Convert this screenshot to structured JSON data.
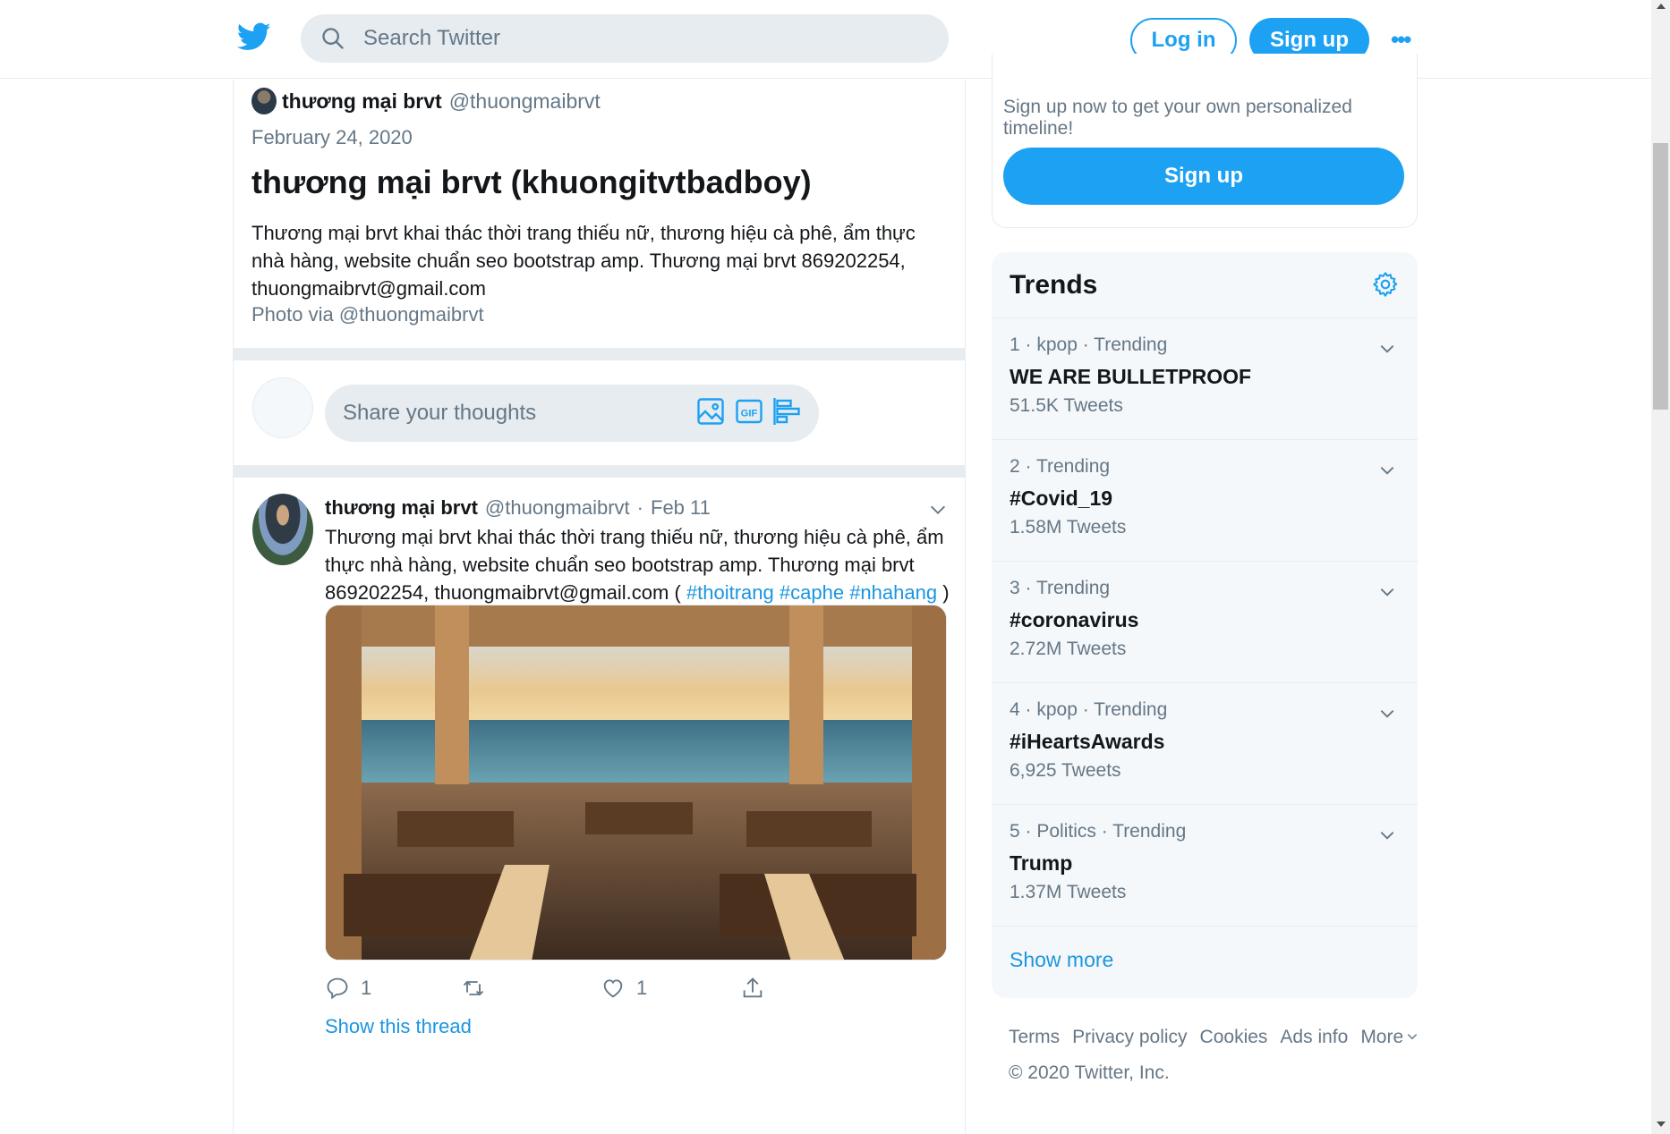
{
  "header": {
    "search_placeholder": "Search Twitter",
    "login_label": "Log in",
    "signup_label": "Sign up",
    "more_label": "•••"
  },
  "moment": {
    "author_name": "thương mại brvt",
    "author_handle": "@thuongmaibrvt",
    "date": "February 24, 2020",
    "title": "thương mại brvt (khuongitvtbadboy)",
    "description": "Thương mại brvt khai thác thời trang thiếu nữ, thương hiệu cà phê, ẩm thực nhà hàng, website chuẩn seo bootstrap amp. Thương mại brvt 869202254, thuongmaibrvt@gmail.com",
    "credit": "Photo via @thuongmaibrvt"
  },
  "compose": {
    "placeholder": "Share your thoughts",
    "icons": [
      "image-icon",
      "gif-icon",
      "poll-icon"
    ]
  },
  "tweet": {
    "name": "thương mại brvt",
    "handle": "@thuongmaibrvt",
    "separator": "·",
    "date": "Feb 11",
    "text": "Thương mại brvt khai thác thời trang thiếu nữ, thương hiệu cà phê, ẩm thực nhà hàng, website chuẩn seo bootstrap amp. Thương mại brvt 869202254, thuongmaibrvt@gmail.com ( ",
    "hashtags": [
      "#thoitrang",
      "#caphe",
      "#nhahang"
    ],
    "text_end": " )",
    "reply_count": "1",
    "like_count": "1",
    "show_thread": "Show this thread"
  },
  "sidebar": {
    "signup_prompt": "Sign up now to get your own personalized timeline!",
    "signup_button": "Sign up",
    "trends_title": "Trends",
    "trends": [
      {
        "meta": "1 · kpop · Trending",
        "topic": "WE ARE BULLETPROOF",
        "count": "51.5K Tweets"
      },
      {
        "meta": "2 · Trending",
        "topic": "#Covid_19",
        "count": "1.58M Tweets"
      },
      {
        "meta": "3 · Trending",
        "topic": "#coronavirus",
        "count": "2.72M Tweets"
      },
      {
        "meta": "4 · kpop · Trending",
        "topic": "#iHeartsAwards",
        "count": "6,925 Tweets"
      },
      {
        "meta": "5 · Politics · Trending",
        "topic": "Trump",
        "count": "1.37M Tweets"
      }
    ],
    "show_more": "Show more"
  },
  "footer": {
    "links": [
      "Terms",
      "Privacy policy",
      "Cookies",
      "Ads info",
      "More"
    ],
    "copyright": "© 2020 Twitter, Inc."
  },
  "colors": {
    "accent": "#1da1f2",
    "link": "#1b95e0",
    "muted": "#657786",
    "border": "#e6ecf0",
    "panel": "#f5f8fa"
  }
}
